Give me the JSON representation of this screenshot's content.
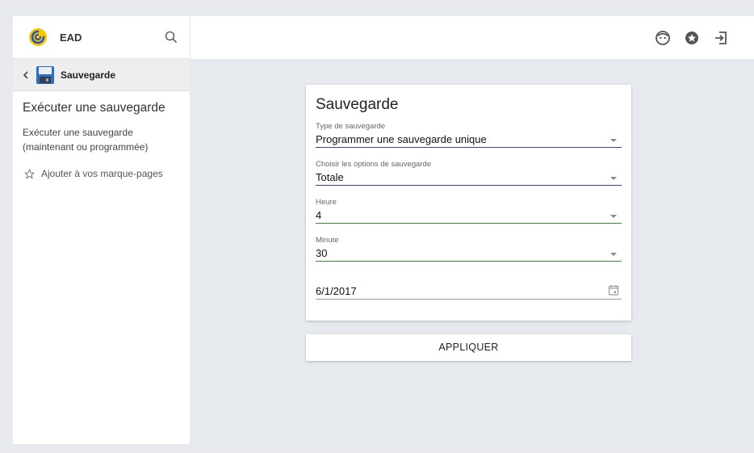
{
  "app": {
    "name": "EAD"
  },
  "sidebar": {
    "back_title": "Sauvegarde",
    "title": "Exécuter une sauvegarde",
    "description": "Exécuter une sauvegarde (maintenant ou programmée)",
    "bookmark_label": "Ajouter à vos marque-pages"
  },
  "topbar": {
    "icons": [
      "user-face-icon",
      "star-circle-icon",
      "logout-icon"
    ]
  },
  "form": {
    "title": "Sauvegarde",
    "fields": [
      {
        "label": "Type de sauvegarde",
        "value": "Programmer une sauvegarde unique"
      },
      {
        "label": "Choisir les options de sauvegarde",
        "value": "Totale"
      },
      {
        "label": "Heure",
        "value": "4"
      },
      {
        "label": "Minute",
        "value": "30"
      },
      {
        "label": "",
        "value": "6/1/2017"
      }
    ],
    "apply_label": "APPLIQUER"
  },
  "colors": {
    "select_underline": "#3f3fa0",
    "valid_underline": "#3c8a3c",
    "background": "#e6e9ed"
  }
}
